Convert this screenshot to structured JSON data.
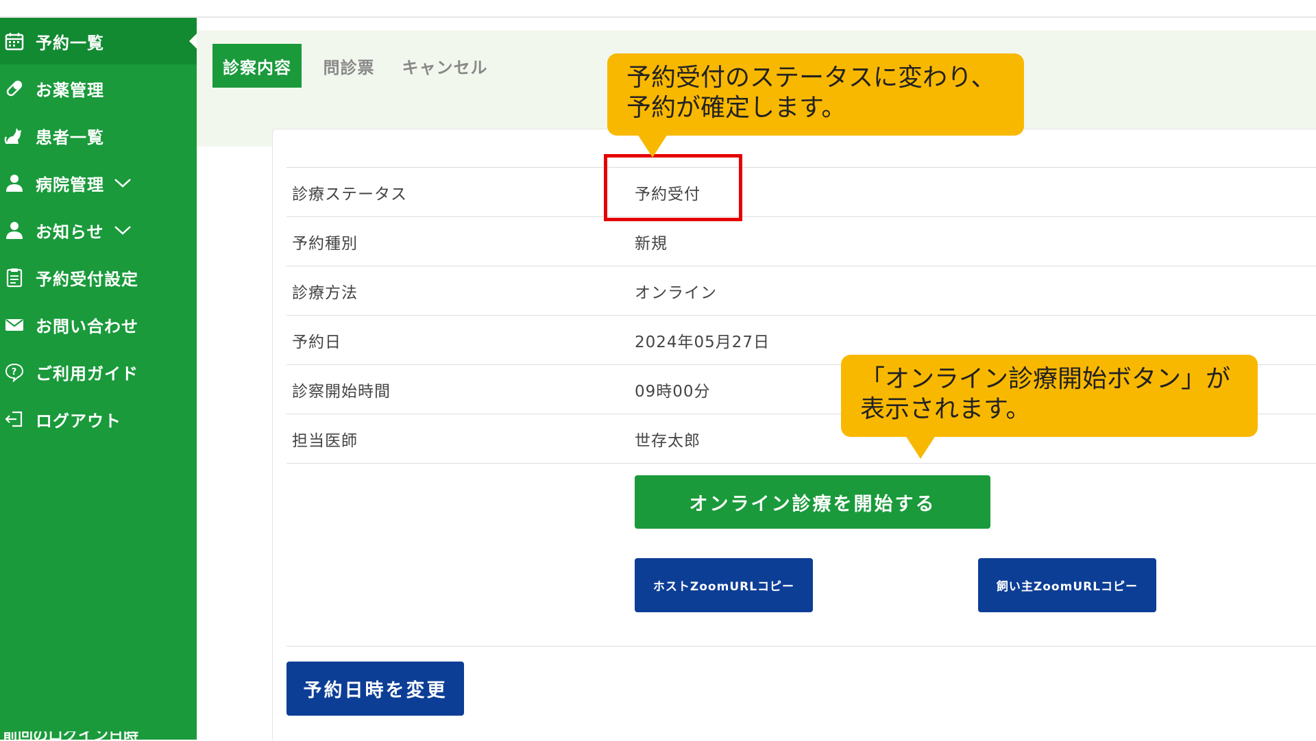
{
  "sidebar": {
    "items": [
      {
        "label": "予約一覧",
        "icon": "calendar-icon",
        "active": true
      },
      {
        "label": "お薬管理",
        "icon": "pill-icon"
      },
      {
        "label": "患者一覧",
        "icon": "cat-icon"
      },
      {
        "label": "病院管理",
        "icon": "person-icon",
        "expandable": true
      },
      {
        "label": "お知らせ",
        "icon": "person-icon",
        "expandable": true
      },
      {
        "label": "予約受付設定",
        "icon": "clipboard-icon"
      },
      {
        "label": "お問い合わせ",
        "icon": "mail-icon"
      },
      {
        "label": "ご利用ガイド",
        "icon": "help-bubble-icon"
      },
      {
        "label": "ログアウト",
        "icon": "logout-icon"
      }
    ],
    "footer": "前回のログイン日時"
  },
  "tabs": [
    {
      "label": "診察内容",
      "active": true
    },
    {
      "label": "問診票"
    },
    {
      "label": "キャンセル"
    }
  ],
  "details": [
    {
      "label": "診療ステータス",
      "value": "予約受付"
    },
    {
      "label": "予約種別",
      "value": "新規"
    },
    {
      "label": "診療方法",
      "value": "オンライン"
    },
    {
      "label": "予約日",
      "value": "2024年05月27日"
    },
    {
      "label": "診察開始時間",
      "value": "09時00分"
    },
    {
      "label": "担当医師",
      "value": "世存太郎"
    }
  ],
  "buttons": {
    "start_online": "オンライン診療を開始する",
    "host_zoom": "ホストZoomURLコピー",
    "owner_zoom": "飼い主ZoomURLコピー",
    "change_datetime": "予約日時を変更"
  },
  "callouts": {
    "status": [
      "予約受付のステータスに変わり、",
      "予約が確定します。"
    ],
    "button": [
      "「オンライン診療開始ボタン」が",
      "表示されます。"
    ]
  },
  "colors": {
    "sidebar_green": "#1a9a3b",
    "button_navy": "#0d3e96",
    "callout_yellow": "#f9b800",
    "highlight_red": "#e60000"
  }
}
